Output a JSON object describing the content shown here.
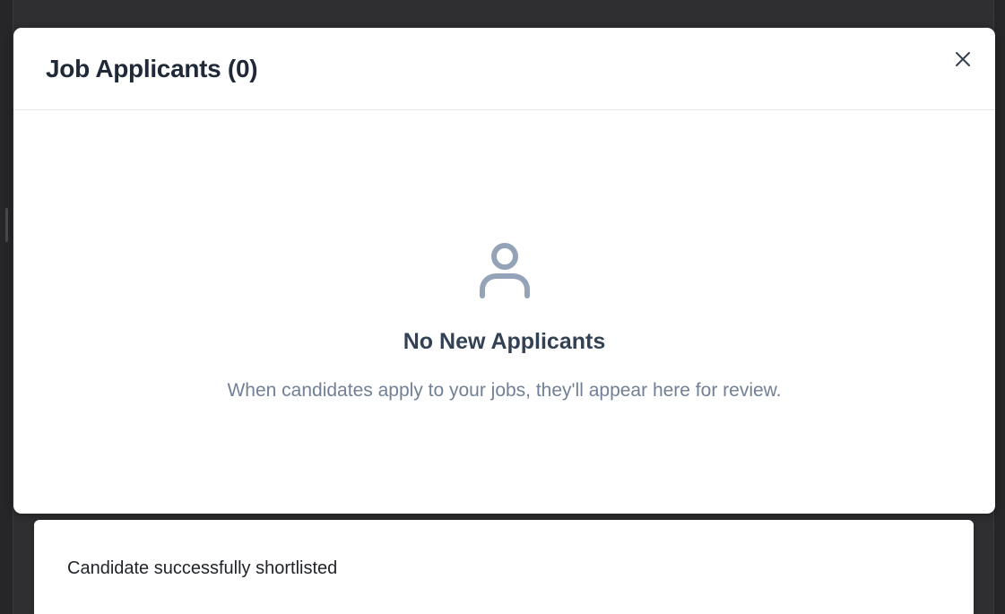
{
  "modal": {
    "title": "Job Applicants (0)",
    "close_icon": "close-icon"
  },
  "empty_state": {
    "icon": "user-icon",
    "title": "No New Applicants",
    "description": "When candidates apply to your jobs, they'll appear here for review."
  },
  "toast": {
    "message": "Candidate successfully shortlisted"
  },
  "colors": {
    "backdrop": "#2f2f31",
    "title_text": "#1f2937",
    "empty_title": "#334155",
    "empty_desc": "#718096",
    "icon": "#94a3b8"
  }
}
